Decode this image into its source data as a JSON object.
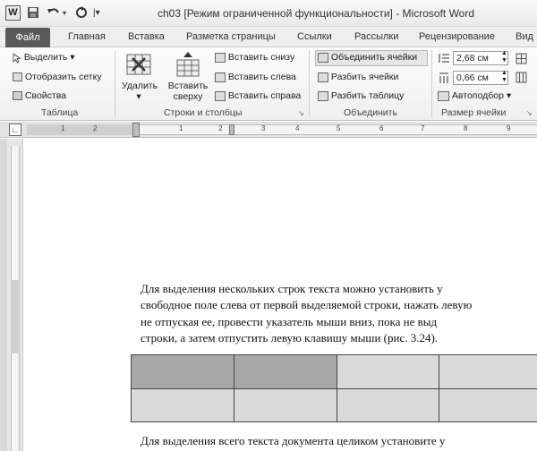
{
  "app": {
    "title": "ch03 [Режим ограниченной функциональности]  -  Microsoft Word",
    "word_icon": "W"
  },
  "quick_access": {
    "save_icon": "save-icon",
    "undo_icon": "undo-icon",
    "redo_icon": "redo-icon",
    "customize_icon": "customize-icon"
  },
  "tabs": {
    "file": "Файл",
    "items": [
      "Главная",
      "Вставка",
      "Разметка страницы",
      "Ссылки",
      "Рассылки",
      "Рецензирование",
      "Вид"
    ]
  },
  "ribbon": {
    "table_group": {
      "label": "Таблица",
      "select": "Выделить ▾",
      "show_grid": "Отобразить сетку",
      "properties": "Свойства"
    },
    "rows_cols_group": {
      "label": "Строки и столбцы",
      "delete": "Удалить",
      "delete_arrow": "▾",
      "insert_above_1": "Вставить",
      "insert_above_2": "сверху",
      "insert_below": "Вставить снизу",
      "insert_left": "Вставить слева",
      "insert_right": "Вставить справа"
    },
    "merge_group": {
      "label": "Объединить",
      "merge_cells": "Объединить ячейки",
      "split_cells": "Разбить ячейки",
      "split_table": "Разбить таблицу"
    },
    "cell_size_group": {
      "label": "Размер ячейки",
      "height": "2,68 см",
      "width": "0,66 см",
      "autofit": "Автоподбор ▾"
    }
  },
  "ruler": {
    "numbers": [
      "1",
      "2",
      "1",
      "2",
      "3",
      "4",
      "5",
      "6",
      "7",
      "8",
      "9"
    ]
  },
  "document": {
    "para1": [
      "Для выделения нескольких строк текста можно установить у",
      "свободное поле слева от первой выделяемой строки, нажать левую",
      "не отпуская ее, провести указатель мыши вниз, пока не выд",
      "строки, а затем отпустить левую клавишу мыши (рис. 3.24)."
    ],
    "para2": "Для выделения всего текста документа целиком установите у"
  }
}
